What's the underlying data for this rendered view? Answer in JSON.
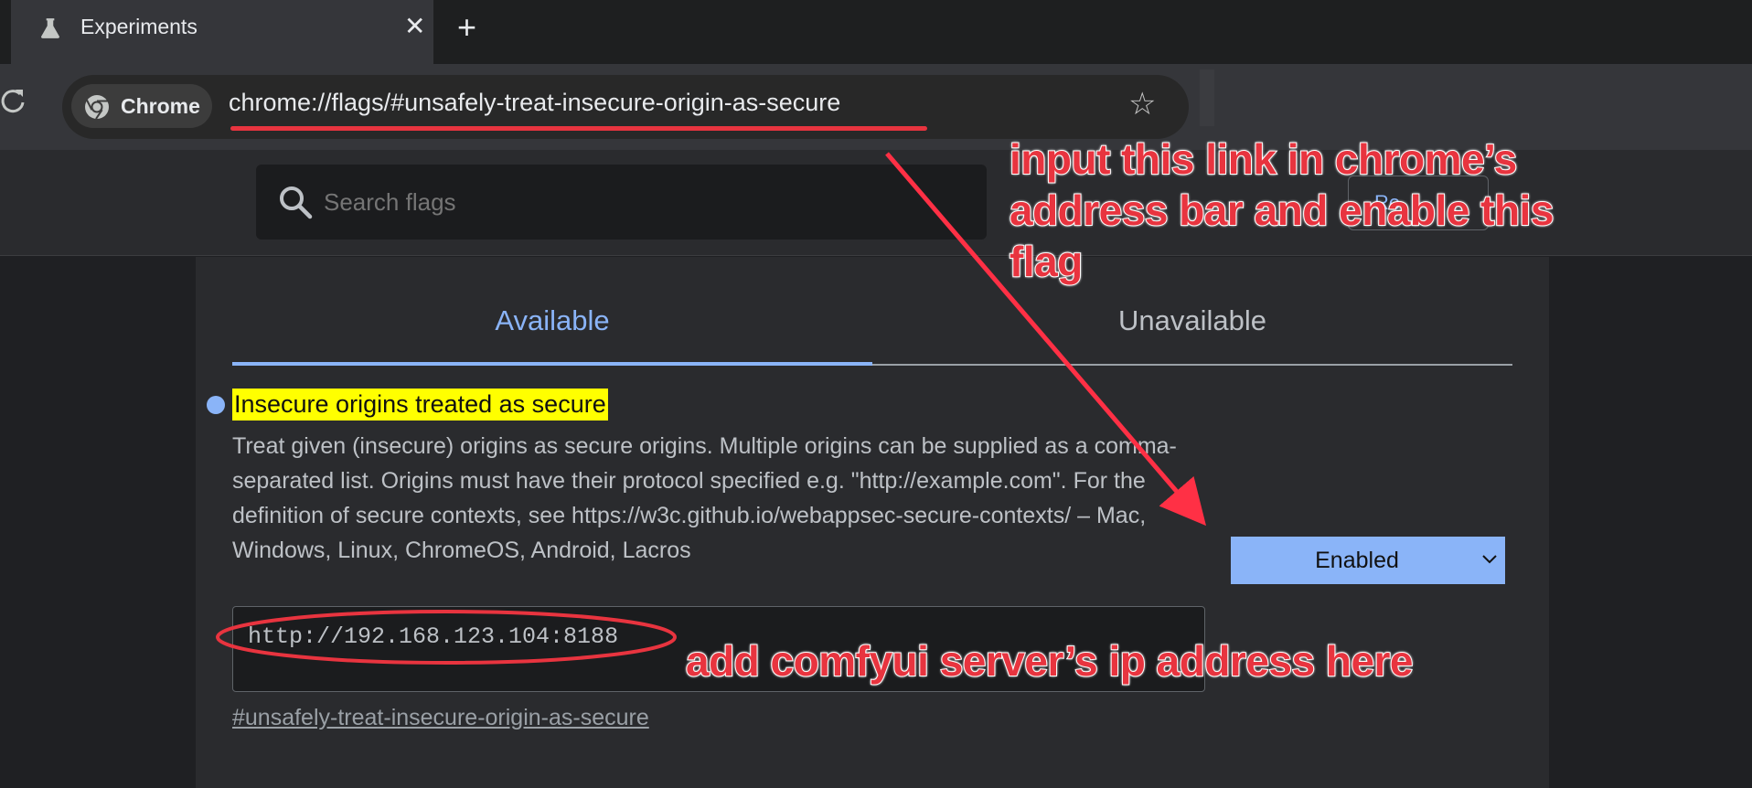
{
  "tab": {
    "title": "Experiments",
    "close_glyph": "✕",
    "new_tab_glyph": "+"
  },
  "omnibox": {
    "chip_label": "Chrome",
    "url": "chrome://flags/#unsafely-treat-insecure-origin-as-secure",
    "star_glyph": "☆"
  },
  "search": {
    "placeholder": "Search flags"
  },
  "reset": {
    "label": "Re"
  },
  "tabs": {
    "available": "Available",
    "unavailable": "Unavailable"
  },
  "flag": {
    "title": "Insecure origins treated as secure",
    "description": "Treat given (insecure) origins as secure origins. Multiple origins can be supplied as a comma-separated list. Origins must have their protocol specified e.g. \"http://example.com\". For the definition of secure contexts, see https://w3c.github.io/webappsec-secure-contexts/ – Mac, Windows, Linux, ChromeOS, Android, Lacros",
    "state": "Enabled",
    "origins_value": "http://192.168.123.104:8188",
    "link": "#unsafely-treat-insecure-origin-as-secure"
  },
  "annotations": {
    "top": "input this link in chrome’s address bar and enable this flag",
    "bottom": "add comfyui server’s ip address here",
    "color": "#e8343f"
  },
  "icons": {
    "tab": "flask-icon",
    "reload": "reload-icon",
    "chip": "chrome-logo-icon",
    "star": "star-icon",
    "search": "search-icon",
    "select": "chevron-down-icon"
  }
}
